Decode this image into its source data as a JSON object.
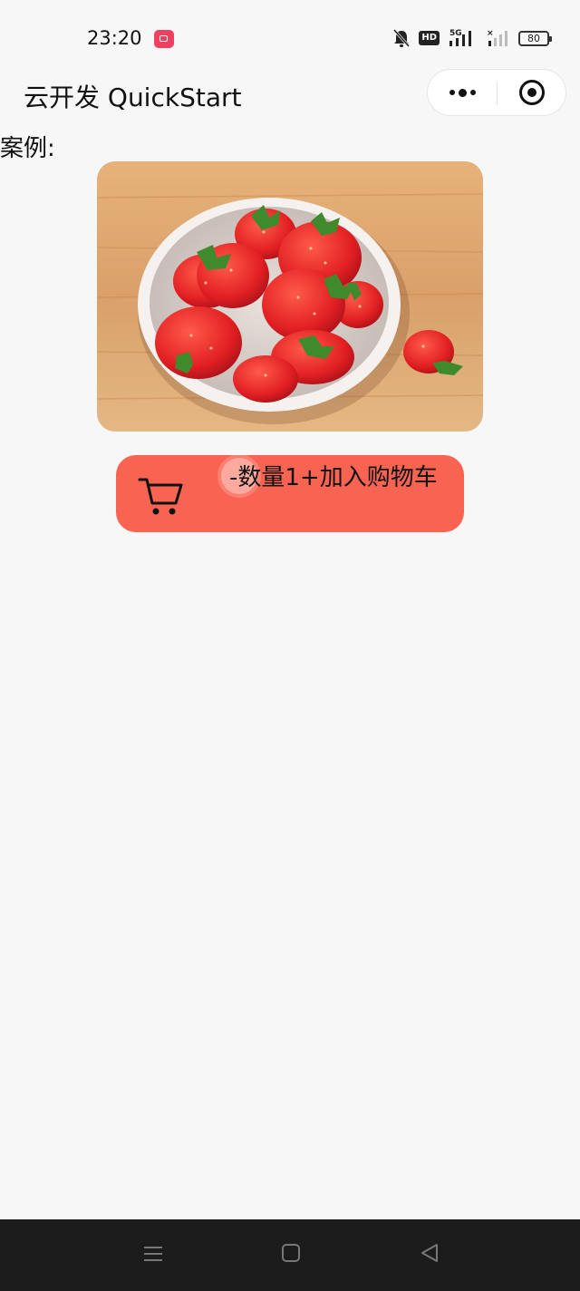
{
  "status_bar": {
    "time": "23:20",
    "network": "5G",
    "battery": "80",
    "icons": [
      "screen-record-icon",
      "bell-muted-icon",
      "hd-icon",
      "signal-5g-icon",
      "signal-weak-icon",
      "battery-icon"
    ],
    "accent_record": "#ef4062"
  },
  "nav": {
    "title": "云开发 QuickStart",
    "more_icon": "more-dots-icon",
    "close_icon": "target-close-icon"
  },
  "content": {
    "section_label": "案例:",
    "product_image_alt": "strawberries-in-bowl",
    "cart_button": {
      "label": "-数量1+加入购物车",
      "icon": "shopping-cart-icon",
      "color": "#f96452"
    }
  },
  "system_nav": {
    "icons": [
      "menu-lines-icon",
      "home-square-icon",
      "back-triangle-icon"
    ]
  }
}
